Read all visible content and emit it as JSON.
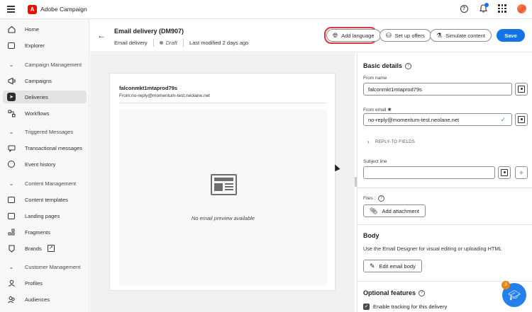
{
  "app": {
    "title": "Adobe Campaign",
    "logo_letter": "A"
  },
  "topbar": {
    "icons": [
      "help-icon",
      "bell-icon",
      "apps-icon",
      "avatar"
    ]
  },
  "sidebar": {
    "items": [
      {
        "label": "Home",
        "icon": "home-icon"
      },
      {
        "label": "Explorer",
        "icon": "explorer-icon"
      },
      {
        "label": "Campaign Management",
        "type": "section"
      },
      {
        "label": "Campaigns",
        "icon": "campaigns-icon"
      },
      {
        "label": "Deliveries",
        "icon": "deliveries-icon",
        "active": true
      },
      {
        "label": "Workflows",
        "icon": "workflows-icon"
      },
      {
        "label": "Triggered Messages",
        "type": "section"
      },
      {
        "label": "Transactional messages",
        "icon": "transactional-icon"
      },
      {
        "label": "Event history",
        "icon": "event-history-icon"
      },
      {
        "label": "Content Management",
        "type": "section"
      },
      {
        "label": "Content templates",
        "icon": "content-templates-icon"
      },
      {
        "label": "Landing pages",
        "icon": "landing-pages-icon"
      },
      {
        "label": "Fragments",
        "icon": "fragments-icon"
      },
      {
        "label": "Brands",
        "icon": "brands-icon"
      },
      {
        "label": "Customer Management",
        "type": "section"
      },
      {
        "label": "Profiles",
        "icon": "profiles-icon"
      },
      {
        "label": "Audiences",
        "icon": "audiences-icon"
      }
    ]
  },
  "header": {
    "title": "Email delivery (DM907)",
    "type": "Email delivery",
    "status": "Draft",
    "modified": "Last modified 2 days ago",
    "buttons": {
      "add_language": "Add language",
      "setup_offers": "Set up offers",
      "simulate": "Simulate content",
      "save": "Save"
    }
  },
  "preview": {
    "from_name": "falconmkt1mtaprod79s",
    "from_line": "From:no-reply@momentum-test.neolane.net",
    "empty_text": "No email preview available"
  },
  "panel": {
    "basic_details_title": "Basic details",
    "from_name_label": "From name",
    "from_name_value": "falconmkt1mtaprod79s",
    "from_email_label": "From email",
    "from_email_value": "no-reply@momentum-test.neolane.net",
    "reply_to_label": "REPLY-TO FIELDS",
    "subject_label": "Subject line",
    "subject_value": "",
    "files_label": "Files :",
    "add_attachment": "Add attachment",
    "body_title": "Body",
    "body_desc": "Use the Email Designer for visual editing or uploading HTML",
    "edit_body": "Edit email body",
    "optional_title": "Optional features",
    "tracking_label": "Enable tracking for this delivery",
    "tracking_checked": true
  },
  "fab": {
    "badge": "3"
  },
  "colors": {
    "accent": "#1473e6",
    "highlight": "#d7373f",
    "brand": "#eb1000"
  }
}
